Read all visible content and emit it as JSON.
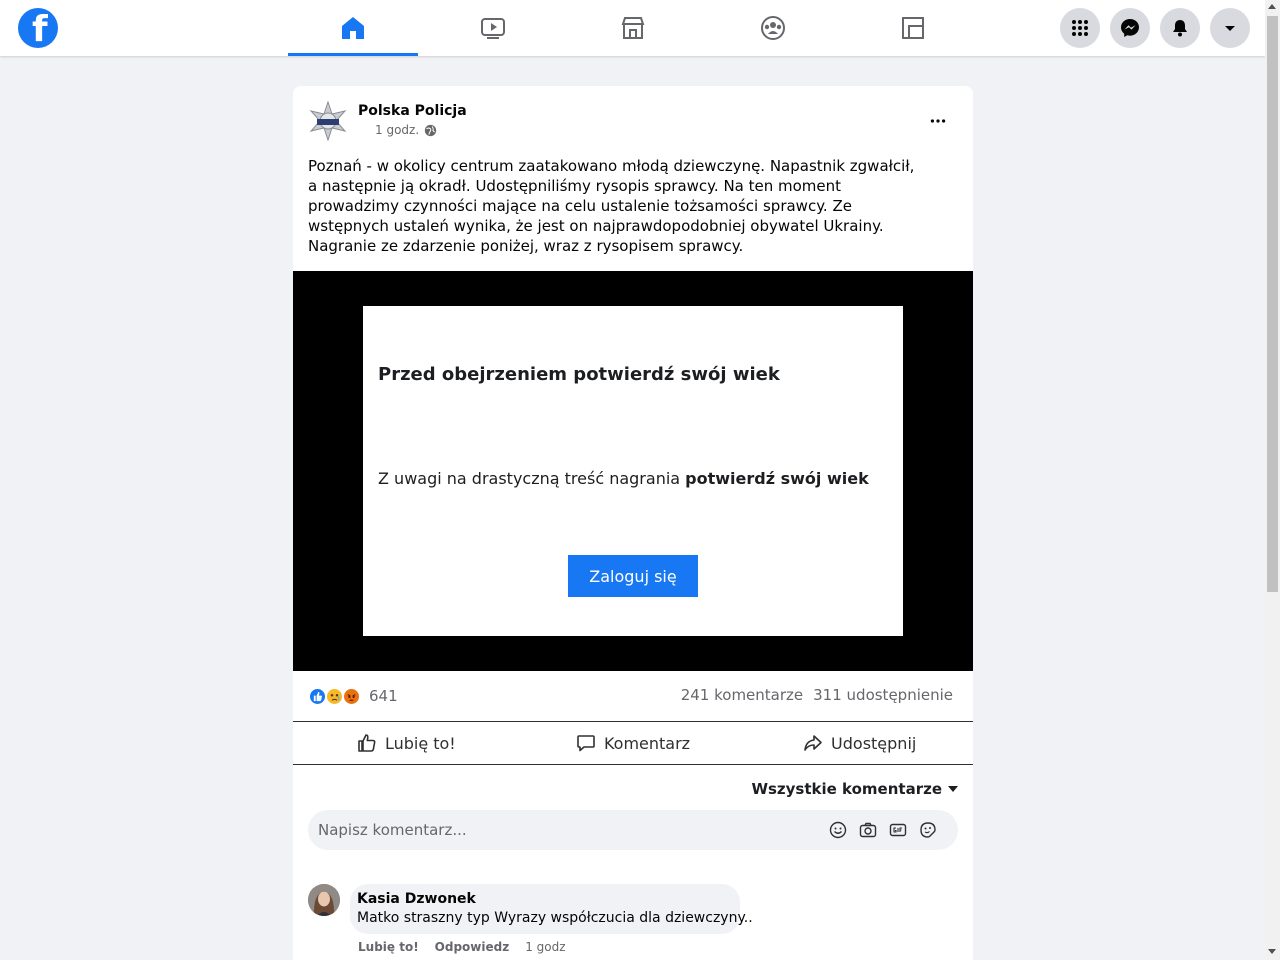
{
  "topbar": {
    "logo_letter": "f",
    "tabs": [
      {
        "name": "home",
        "icon": "home-icon",
        "active": true
      },
      {
        "name": "watch",
        "icon": "video-icon",
        "active": false
      },
      {
        "name": "marketplace",
        "icon": "store-icon",
        "active": false
      },
      {
        "name": "groups",
        "icon": "groups-icon",
        "active": false
      },
      {
        "name": "gaming",
        "icon": "gaming-icon",
        "active": false
      }
    ],
    "right_buttons": [
      "menu-grid-icon",
      "messenger-icon",
      "notifications-icon",
      "account-caret-icon"
    ]
  },
  "post": {
    "author": "Polska Policja",
    "time": "1 godz.",
    "privacy_icon": "globe-icon",
    "text": "Poznań - w okolicy centrum zaatakowano młodą dziewczynę. Napastnik zgwałcił, a następnie ją okradł. Udostępniliśmy rysopis sprawcy. Na ten moment prowadzimy czynności mające na celu ustalenie tożsamości sprawcy. Ze wstępnych ustaleń wynika, że jest on najprawdopodobniej obywatel Ukrainy. Nagranie ze zdarzenie poniżej, wraz z rysopisem sprawcy.",
    "age_gate": {
      "title": "Przed obejrzeniem potwierdź swój wiek",
      "message_prefix": "Z uwagi na drastyczną treść nagrania ",
      "message_bold": "potwierdź swój wiek",
      "button": "Zaloguj się"
    },
    "reactions": {
      "types": [
        "like",
        "sad",
        "angry"
      ],
      "count": "641",
      "comments": "241 komentarze",
      "shares": "311 udostępnienie"
    },
    "actions": {
      "like": "Lubię to!",
      "comment": "Komentarz",
      "share": "Udostępnij"
    },
    "comments_filter": "Wszystkie komentarze",
    "comment_placeholder": "Napisz komentarz...",
    "comment": {
      "author": "Kasia Dzwonek",
      "text": "Matko straszny typ Wyrazy współczucia dla dziewczyny..",
      "like": "Lubię to!",
      "reply": "Odpowiedz",
      "time": "1 godz"
    }
  },
  "colors": {
    "accent": "#1877f2",
    "background": "#f0f2f5"
  }
}
